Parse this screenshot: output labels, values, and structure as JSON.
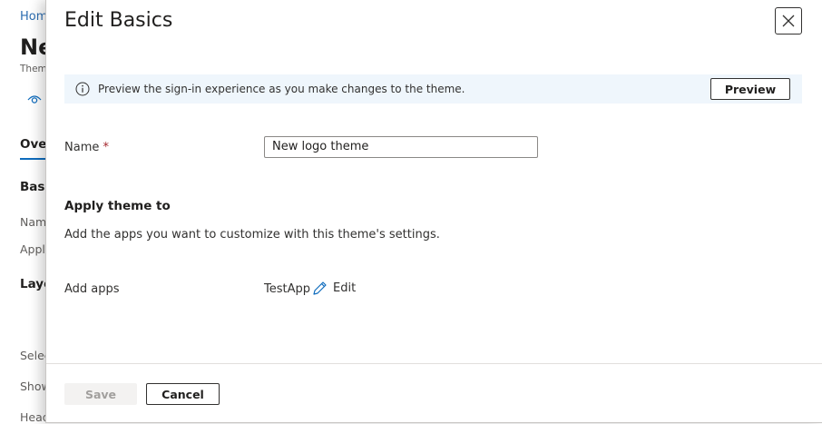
{
  "background": {
    "breadcrumb": "Hom",
    "page_title": "Ne",
    "page_subtitle": "Them",
    "tab_overview": "Ove",
    "section_basics": "Basi",
    "row_name": "Nam",
    "row_apply": "Appl",
    "section_layout": "Layo",
    "row_select": "Selec",
    "row_show": "Show",
    "row_header": "Head"
  },
  "panel": {
    "title": "Edit Basics",
    "banner": {
      "message": "Preview the sign-in experience as you make changes to the theme.",
      "preview_label": "Preview"
    },
    "name_label": "Name",
    "name_required": "*",
    "name_value": "New logo theme",
    "apply_heading": "Apply theme to",
    "apply_description": "Add the apps you want to customize with this theme's settings.",
    "add_apps_label": "Add apps",
    "add_apps_value": "TestApp",
    "edit_label": "Edit",
    "save_label": "Save",
    "cancel_label": "Cancel"
  },
  "colors": {
    "accent": "#0f6cbd",
    "banner_bg": "#eff6fc",
    "required": "#a4262c"
  },
  "icons": [
    "eye-icon",
    "close-icon",
    "info-icon",
    "pencil-icon"
  ]
}
